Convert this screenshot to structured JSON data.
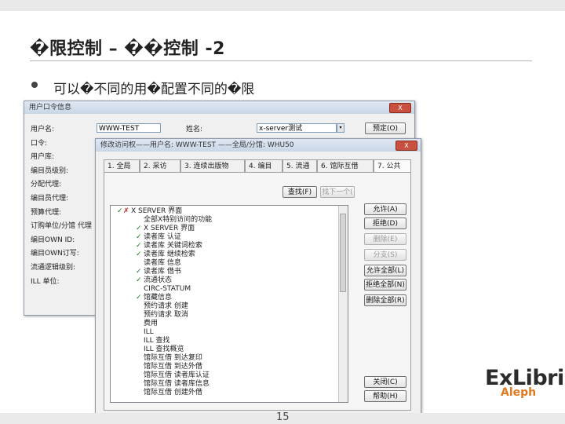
{
  "slide": {
    "title": "�限控制 – ��控制 -2",
    "bullet": "可以�不同的用�配置不同的�限",
    "page_number": "15"
  },
  "user_window": {
    "title": "用户口令信息",
    "close": "X",
    "fields": [
      {
        "label": "用户名:",
        "value": "WWW-TEST"
      },
      {
        "label": "口令:"
      },
      {
        "label": "用户库:"
      },
      {
        "label": "编目员级别:"
      },
      {
        "label": "分配代理:"
      },
      {
        "label": "编目员代理:"
      },
      {
        "label": "预算代理:"
      },
      {
        "label": "订购单位/分馆 代理"
      },
      {
        "label": "编目OWN ID:"
      },
      {
        "label": "编目OWN订写:"
      },
      {
        "label": "流通逻辑级别:"
      },
      {
        "label": "ILL 单位:"
      }
    ],
    "name_label": "姓名:",
    "name_value": "x-server测试",
    "save_button": "预定(O)"
  },
  "perm_window": {
    "title": "修改访问权——用户名: WWW-TEST ——全局/分馆: WHU50",
    "close": "X",
    "tabs": [
      "1. 全局",
      "2. 采访",
      "3. 连续出版物",
      "4. 编目",
      "5. 流通",
      "6. 馆际互借",
      "7. 公共"
    ],
    "active_tab": 6,
    "search_button": "查找(F)",
    "next_button": "找下一个(",
    "tree": [
      {
        "mark": "check-x",
        "text": "X SERVER 界面"
      },
      {
        "mark": "none",
        "text": "全部X特别访问的功能"
      },
      {
        "mark": "check",
        "text": "X SERVER 界面"
      },
      {
        "mark": "check",
        "text": "读者库 认证"
      },
      {
        "mark": "check",
        "text": "读者库 关键词检索"
      },
      {
        "mark": "check",
        "text": "读者库 继续检索"
      },
      {
        "mark": "none",
        "text": "读者库 信息"
      },
      {
        "mark": "check",
        "text": "读者库 借书"
      },
      {
        "mark": "check",
        "text": "流通状态"
      },
      {
        "mark": "none",
        "text": "CIRC-STATUM"
      },
      {
        "mark": "check",
        "text": "馆藏信息"
      },
      {
        "mark": "none",
        "text": "预约请求 创建"
      },
      {
        "mark": "none",
        "text": "预约请求 取消"
      },
      {
        "mark": "none",
        "text": "费用"
      },
      {
        "mark": "none",
        "text": "ILL"
      },
      {
        "mark": "none",
        "text": "ILL 查找"
      },
      {
        "mark": "none",
        "text": "ILL 查找概览"
      },
      {
        "mark": "none",
        "text": "馆际互借 到达复印"
      },
      {
        "mark": "none",
        "text": "馆际互借 到达外借"
      },
      {
        "mark": "none",
        "text": "馆际互借 读者库认证"
      },
      {
        "mark": "none",
        "text": "馆际互借 读者库信息"
      },
      {
        "mark": "none",
        "text": "馆际互借 创建外借"
      }
    ],
    "side_buttons": [
      {
        "label": "允许(A)",
        "enabled": true
      },
      {
        "label": "拒绝(D)",
        "enabled": true
      },
      {
        "label": "删除(E)",
        "enabled": false
      },
      {
        "label": "分支(S)",
        "enabled": false
      },
      {
        "label": "允许全部(L)",
        "enabled": true
      },
      {
        "label": "拒绝全部(N)",
        "enabled": true
      },
      {
        "label": "删除全部(R)",
        "enabled": true
      }
    ],
    "close_button": "关闭(C)",
    "help_button": "帮助(H)"
  },
  "logo": {
    "name": "ExLibris",
    "sub": "Aleph"
  },
  "colors": {
    "check": "#1c7a1c",
    "x": "#c0231b",
    "logo_orange": "#e07a1f",
    "title_close": "#c9503f"
  }
}
